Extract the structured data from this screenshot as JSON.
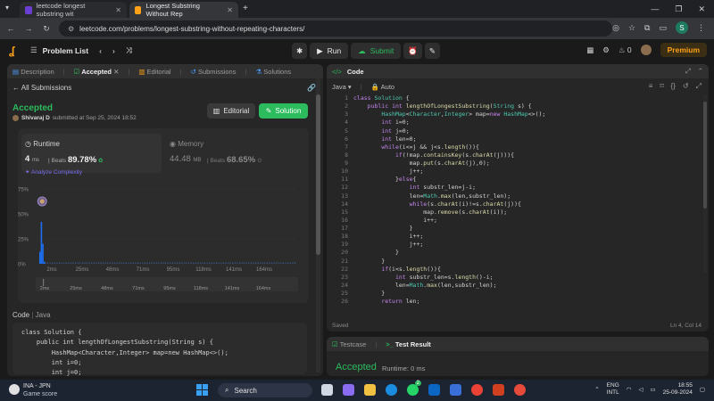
{
  "browser": {
    "tabs": [
      {
        "title": "leetcode longest substring wit",
        "active": false
      },
      {
        "title": "Longest Substring Without Rep",
        "active": true
      }
    ],
    "url": "leetcode.com/problems/longest-substring-without-repeating-characters/",
    "profile_initial": "S"
  },
  "leetcode": {
    "problem_list": "Problem List",
    "run": "Run",
    "submit": "Submit",
    "streak": "0",
    "premium": "Premium"
  },
  "left_panel": {
    "tabs": [
      "Description",
      "Accepted",
      "Editorial",
      "Submissions",
      "Solutions"
    ],
    "back": "All Submissions",
    "status": "Accepted",
    "user": "Shivaraj D",
    "submitted_text": "submitted at Sep 25, 2024 18:52",
    "editorial_btn": "Editorial",
    "solution_btn": "Solution",
    "runtime": {
      "title": "Runtime",
      "value": "4",
      "unit": "ms",
      "beats_label": "Beats",
      "beats": "89.78%"
    },
    "analyze": "Analyze Complexity",
    "memory": {
      "title": "Memory",
      "value": "44.48",
      "unit": "MB",
      "beats_label": "Beats",
      "beats": "68.65%"
    },
    "code_label": "Code",
    "language": "Java",
    "code_snippet": "class Solution {\n    public int lengthOfLongestSubstring(String s) {\n        HashMap<Character,Integer> map=new HashMap<>();\n        int i=0;\n        int j=0;"
  },
  "chart_data": {
    "type": "bar",
    "yticks": [
      "75%",
      "50%",
      "25%",
      "0%"
    ],
    "ylim": [
      0,
      75
    ],
    "xticks": [
      "2ms",
      "25ms",
      "48ms",
      "71ms",
      "95ms",
      "118ms",
      "141ms",
      "164ms"
    ],
    "nav_ticks": [
      "2ms",
      "25ms",
      "48ms",
      "71ms",
      "95ms",
      "118ms",
      "141ms",
      "164ms"
    ],
    "bars": [
      {
        "x": 2,
        "value": 12
      },
      {
        "x": 3,
        "value": 42
      },
      {
        "x": 4,
        "value": 20
      },
      {
        "x": 5,
        "value": 2
      }
    ],
    "highlight_x": 4
  },
  "editor": {
    "title": "Code",
    "language": "Java",
    "mode": "Auto",
    "saved": "Saved",
    "cursor": "Ln 4, Col 14",
    "lines": [
      "class Solution {",
      "    public int lengthOfLongestSubstring(String s) {",
      "        HashMap<Character,Integer> map=new HashMap<>();",
      "        int i=0;",
      "        int j=0;",
      "        int len=0;",
      "        while(i<=j && j<s.length()){",
      "            if(!map.containsKey(s.charAt(j))){",
      "                map.put(s.charAt(j),0);",
      "                j++;",
      "            }else{",
      "                int substr_len=j-i;",
      "                len=Math.max(len,substr_len);",
      "                while(s.charAt(i)!=s.charAt(j)){",
      "                    map.remove(s.charAt(i));",
      "                    i++;",
      "                }",
      "                i++;",
      "                j++;",
      "            }",
      "        }",
      "        if(i<s.length()){",
      "            int substr_len=s.length()-i;",
      "            len=Math.max(len,substr_len);",
      "        }",
      "        return len;"
    ]
  },
  "bottom_panel": {
    "testcase": "Testcase",
    "test_result": "Test Result",
    "status": "Accepted",
    "runtime": "Runtime: 0 ms"
  },
  "taskbar": {
    "left_title": "INA - JPN",
    "left_sub": "Game score",
    "search": "Search",
    "lang_1": "ENG",
    "lang_2": "INTL",
    "time": "18:55",
    "date": "25-09-2024",
    "notification_count": "2"
  },
  "colors": {
    "accent_green": "#2cbb5d",
    "orange": "#ffa116",
    "bar_blue": "#1d6ff2",
    "analyze_purple": "#7a6ef0"
  }
}
